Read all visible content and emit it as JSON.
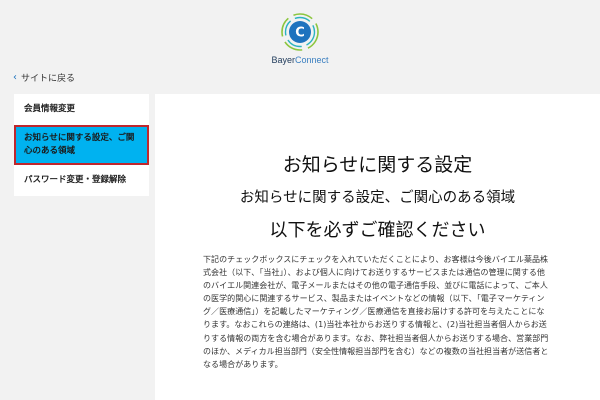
{
  "brand": {
    "logo_letter": "C",
    "name_part1": "Bayer",
    "name_part2": "Connect"
  },
  "nav": {
    "back_label": "サイトに戻る"
  },
  "sidebar": {
    "items": [
      {
        "label": "会員情報変更",
        "active": false
      },
      {
        "label": "お知らせに関する設定、ご関心のある領域",
        "active": true
      },
      {
        "label": "パスワード変更・登録解除",
        "active": false
      }
    ]
  },
  "main": {
    "title": "お知らせに関する設定",
    "subtitle": "お知らせに関する設定、ご関心のある領域",
    "notice": "以下を必ずご確認ください",
    "body": "下記のチェックボックスにチェックを入れていただくことにより、お客様は今後バイエル薬品株式会社（以下、「当社」）、および個人に向けてお送りするサービスまたは通信の管理に関する他のバイエル関連会社が、電子メールまたはその他の電子通信手段、並びに電話によって、ご本人の医学的関心に関連するサービス、製品またはイベントなどの情報（以下、「電子マーケティング／医療通信」）を記載したマーケティング／医療通信を直接お届けする許可を与えたことになります。なおこれらの連絡は、(1)当社本社からお送りする情報と、(2)当社担当者個人からお送りする情報の両方を含む場合があります。なお、弊社担当者個人からお送りする場合、営業部門のほか、メディカル担当部門（安全性情報担当部門を含む）などの複数の当社担当者が送信者となる場合があります。"
  },
  "colors": {
    "active_bg": "#00b2f0",
    "active_border": "#c0272d",
    "logo_teal": "#2bb3c0",
    "logo_green": "#8cc63f",
    "logo_blue": "#1e73be"
  }
}
